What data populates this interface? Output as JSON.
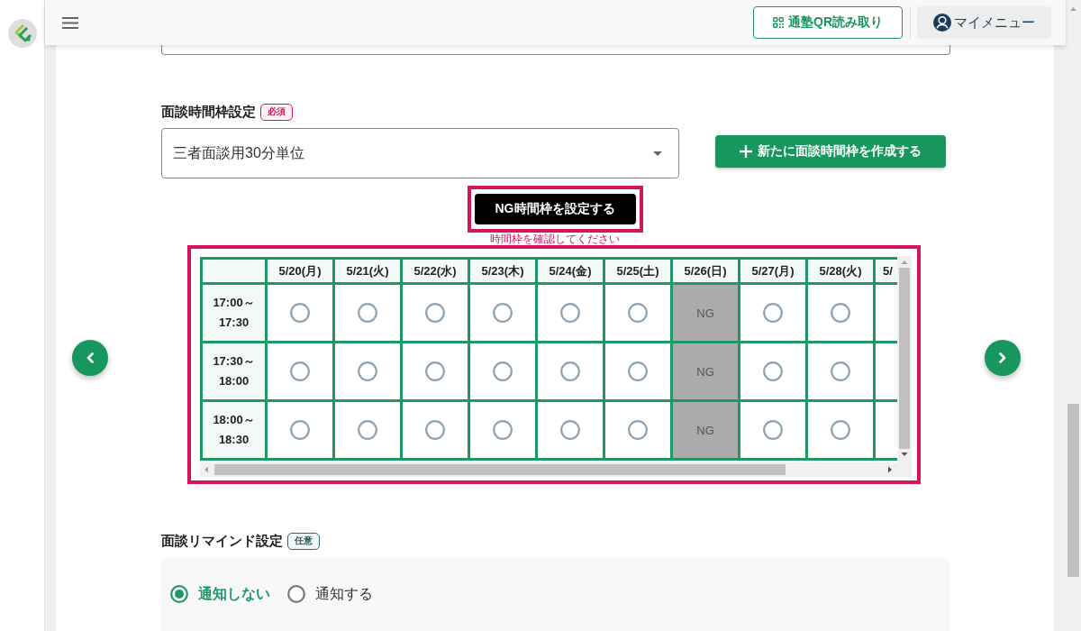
{
  "header": {
    "qr_button": "通塾QR読み取り",
    "my_menu_button": "マイメニュー"
  },
  "time_slot_setting": {
    "label": "面談時間枠設定",
    "badge": {
      "text": "必須",
      "kind": "required"
    },
    "select": {
      "value": "三者面談用30分単位"
    },
    "create_button": "新たに面談時間枠を作成する",
    "ng_button": "NG時間枠を設定する",
    "error_message": "時間枠を確認してください",
    "timetable": {
      "columns": [
        "5/20(月)",
        "5/21(火)",
        "5/22(水)",
        "5/23(木)",
        "5/24(金)",
        "5/25(土)",
        "5/26(日)",
        "5/27(月)",
        "5/28(火)",
        "5/"
      ],
      "rows": [
        {
          "time": "17:00～17:30",
          "cells": [
            {
              "kind": "open"
            },
            {
              "kind": "open"
            },
            {
              "kind": "open"
            },
            {
              "kind": "open"
            },
            {
              "kind": "open"
            },
            {
              "kind": "open"
            },
            {
              "kind": "ng",
              "label": "NG"
            },
            {
              "kind": "open"
            },
            {
              "kind": "open"
            }
          ]
        },
        {
          "time": "17:30～18:00",
          "cells": [
            {
              "kind": "open"
            },
            {
              "kind": "open"
            },
            {
              "kind": "open"
            },
            {
              "kind": "open"
            },
            {
              "kind": "open"
            },
            {
              "kind": "open"
            },
            {
              "kind": "ng",
              "label": "NG"
            },
            {
              "kind": "open"
            },
            {
              "kind": "open"
            }
          ]
        },
        {
          "time": "18:00～18:30",
          "cells": [
            {
              "kind": "open"
            },
            {
              "kind": "open"
            },
            {
              "kind": "open"
            },
            {
              "kind": "open"
            },
            {
              "kind": "open"
            },
            {
              "kind": "open"
            },
            {
              "kind": "ng",
              "label": "NG"
            },
            {
              "kind": "open"
            },
            {
              "kind": "open"
            }
          ]
        }
      ]
    }
  },
  "reminder_setting": {
    "label": "面談リマインド設定",
    "badge": {
      "text": "任意",
      "kind": "optional"
    },
    "options": [
      {
        "label": "通知しない",
        "selected": true
      },
      {
        "label": "通知する",
        "selected": false
      }
    ]
  }
}
